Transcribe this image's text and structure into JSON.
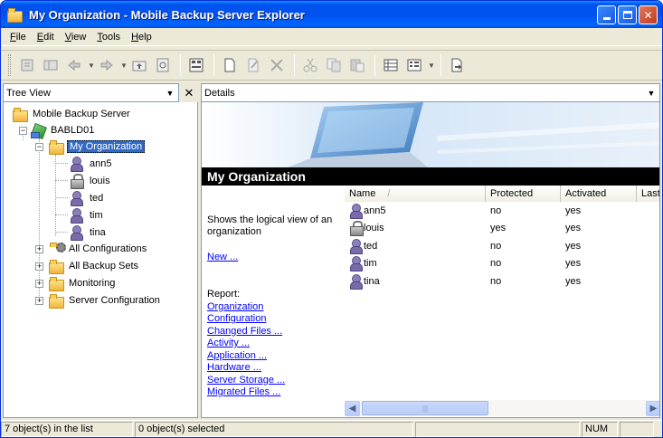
{
  "window": {
    "title": "My Organization - Mobile Backup  Server Explorer",
    "accent": "#0054e3"
  },
  "menu": [
    {
      "underline": "F",
      "rest": "ile"
    },
    {
      "underline": "E",
      "rest": "dit"
    },
    {
      "underline": "V",
      "rest": "iew"
    },
    {
      "underline": "T",
      "rest": "ools"
    },
    {
      "underline": "H",
      "rest": "elp"
    }
  ],
  "toolbar": {
    "icons": [
      "up-icon",
      "tree-icon",
      "back-icon",
      "forward-icon",
      "folder-up-icon",
      "refresh-icon",
      "properties-icon",
      "new-icon",
      "edit-icon",
      "delete-icon",
      "cut-icon",
      "copy-icon",
      "paste-icon",
      "details-view-icon",
      "list-view-icon",
      "export-icon"
    ]
  },
  "left_pane": {
    "header": "Tree View",
    "close_glyph": "✕"
  },
  "tree": {
    "root": "Mobile Backup Server",
    "server": "BABLD01",
    "org": "My Organization",
    "users": [
      "ann5",
      "louis",
      "ted",
      "tim",
      "tina"
    ],
    "groups": [
      "All Configurations",
      "All Backup Sets",
      "Monitoring",
      "Server Configuration"
    ]
  },
  "right_pane": {
    "header": "Details",
    "banner_title": "My Organization",
    "description": "Shows the logical view of an organization",
    "new_link": "New ...",
    "report_label": "Report:",
    "report_links": [
      "Organization",
      "Configuration",
      "Changed Files ...",
      "Activity ...",
      "Application ...",
      "Hardware ...",
      "Server Storage ...",
      "Migrated Files ..."
    ]
  },
  "list": {
    "columns": [
      "Name",
      "Protected",
      "Activated",
      "Last"
    ],
    "sort_indicator": "/",
    "rows": [
      {
        "name": "ann5",
        "protected": "no",
        "activated": "yes"
      },
      {
        "name": "louis",
        "protected": "yes",
        "activated": "yes"
      },
      {
        "name": "ted",
        "protected": "no",
        "activated": "yes"
      },
      {
        "name": "tim",
        "protected": "no",
        "activated": "yes"
      },
      {
        "name": "tina",
        "protected": "no",
        "activated": "yes"
      }
    ]
  },
  "statusbar": {
    "objects": "7 object(s) in the list",
    "selected": "0 object(s) selected",
    "num": "NUM"
  }
}
